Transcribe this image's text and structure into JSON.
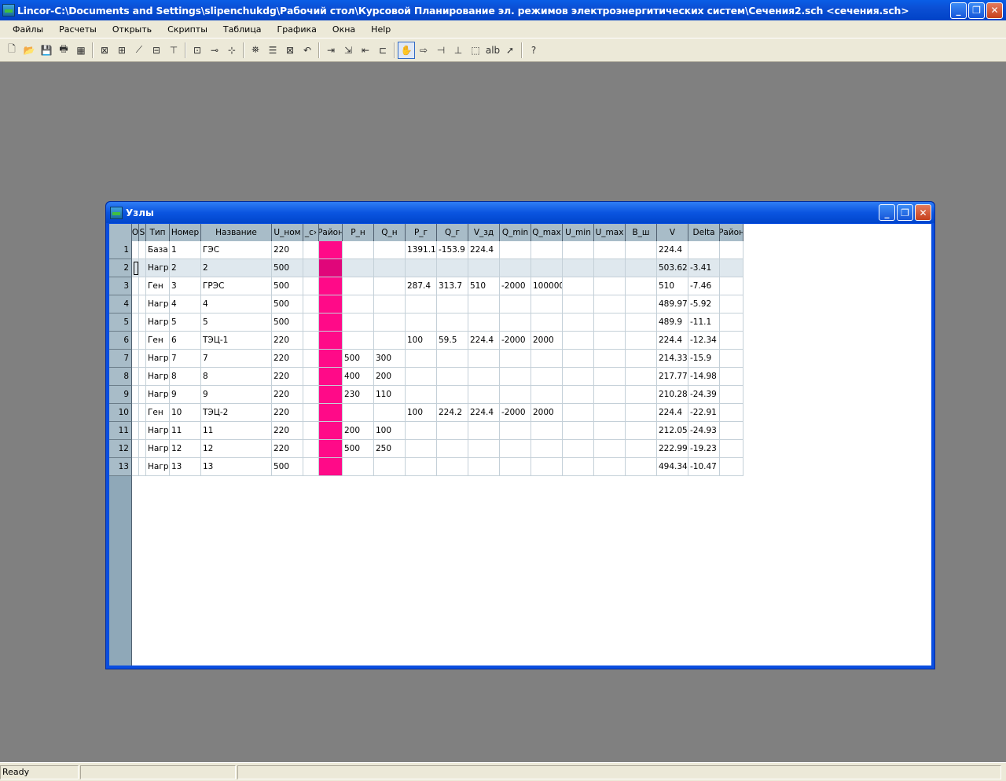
{
  "window": {
    "title": "Lincor-C:\\Documents and Settings\\slipenchukdg\\Рабочий стол\\Курсовой Планирование эл. режимов электроэнергитических систем\\Сечения2.sch <сечения.sch>",
    "minimize": "_",
    "maximize": "❐",
    "close": "✕"
  },
  "menu": [
    "Файлы",
    "Расчеты",
    "Открыть",
    "Скрипты",
    "Таблица",
    "Графика",
    "Окна",
    "Help"
  ],
  "toolbar": [
    "new-file-icon",
    "open-folder-icon",
    "save-icon",
    "print-icon",
    "table-icon",
    "sep",
    "tool-1-icon",
    "tool-2-icon",
    "tool-3-icon",
    "tool-4-icon",
    "tool-5-icon",
    "sep",
    "tool-6-icon",
    "tool-7-icon",
    "tool-8-icon",
    "sep",
    "binoculars-icon",
    "list-icon",
    "excel-icon",
    "undo-icon",
    "sep",
    "node-add-icon",
    "node-link-icon",
    "node-left-icon",
    "node-box-icon",
    "sep",
    "hand-icon",
    "arrow-right-icon",
    "branch-icon",
    "branch-end-icon",
    "select-icon",
    "text-ab-icon",
    "pointer-icon",
    "sep",
    "help-icon"
  ],
  "toolbar_labels": {
    "text-ab-icon": "alb"
  },
  "child": {
    "title": "Узлы",
    "minimize": "_",
    "maximize": "❐",
    "close": "✕"
  },
  "grid": {
    "columns": [
      "",
      "O",
      "S",
      "Тип",
      "Номер",
      "Название",
      "U_ном",
      "_с›",
      "Район",
      "P_н",
      "Q_н",
      "P_г",
      "Q_г",
      "V_зд",
      "Q_min",
      "Q_max",
      "U_min",
      "U_max",
      "B_ш",
      "V",
      "Delta",
      "Район"
    ],
    "rows": [
      [
        "1",
        "",
        "",
        "База",
        "1",
        "ГЭС",
        "220",
        "",
        "",
        "",
        "",
        "1391.1",
        "-153.9",
        "224.4",
        "",
        "",
        "",
        "",
        "",
        "224.4",
        "",
        ""
      ],
      [
        "2",
        "",
        "",
        "Нагр",
        "2",
        "2",
        "500",
        "",
        "",
        "",
        "",
        "",
        "",
        "",
        "",
        "",
        "",
        "",
        "",
        "503.62",
        "-3.41",
        ""
      ],
      [
        "3",
        "",
        "",
        "Ген",
        "3",
        "ГРЭС",
        "500",
        "",
        "",
        "",
        "",
        "287.4",
        "313.7",
        "510",
        "-2000",
        "100000",
        "",
        "",
        "",
        "510",
        "-7.46",
        ""
      ],
      [
        "4",
        "",
        "",
        "Нагр",
        "4",
        "4",
        "500",
        "",
        "",
        "",
        "",
        "",
        "",
        "",
        "",
        "",
        "",
        "",
        "",
        "489.97",
        "-5.92",
        ""
      ],
      [
        "5",
        "",
        "",
        "Нагр",
        "5",
        "5",
        "500",
        "",
        "",
        "",
        "",
        "",
        "",
        "",
        "",
        "",
        "",
        "",
        "",
        "489.9",
        "-11.1",
        ""
      ],
      [
        "6",
        "",
        "",
        "Ген",
        "6",
        "ТЭЦ-1",
        "220",
        "",
        "",
        "",
        "",
        "100",
        "59.5",
        "224.4",
        "-2000",
        "2000",
        "",
        "",
        "",
        "224.4",
        "-12.34",
        ""
      ],
      [
        "7",
        "",
        "",
        "Нагр",
        "7",
        "7",
        "220",
        "",
        "",
        "500",
        "300",
        "",
        "",
        "",
        "",
        "",
        "",
        "",
        "",
        "214.33",
        "-15.9",
        ""
      ],
      [
        "8",
        "",
        "",
        "Нагр",
        "8",
        "8",
        "220",
        "",
        "",
        "400",
        "200",
        "",
        "",
        "",
        "",
        "",
        "",
        "",
        "",
        "217.77",
        "-14.98",
        ""
      ],
      [
        "9",
        "",
        "",
        "Нагр",
        "9",
        "9",
        "220",
        "",
        "",
        "230",
        "110",
        "",
        "",
        "",
        "",
        "",
        "",
        "",
        "",
        "210.28",
        "-24.39",
        ""
      ],
      [
        "10",
        "",
        "",
        "Ген",
        "10",
        "ТЭЦ-2",
        "220",
        "",
        "",
        "",
        "",
        "100",
        "224.2",
        "224.4",
        "-2000",
        "2000",
        "",
        "",
        "",
        "224.4",
        "-22.91",
        ""
      ],
      [
        "11",
        "",
        "",
        "Нагр",
        "11",
        "11",
        "220",
        "",
        "",
        "200",
        "100",
        "",
        "",
        "",
        "",
        "",
        "",
        "",
        "",
        "212.05",
        "-24.93",
        ""
      ],
      [
        "12",
        "",
        "",
        "Нагр",
        "12",
        "12",
        "220",
        "",
        "",
        "500",
        "250",
        "",
        "",
        "",
        "",
        "",
        "",
        "",
        "",
        "222.99",
        "-19.23",
        ""
      ],
      [
        "13",
        "",
        "",
        "Нагр",
        "13",
        "13",
        "500",
        "",
        "",
        "",
        "",
        "",
        "",
        "",
        "",
        "",
        "",
        "",
        "",
        "494.34",
        "-10.47",
        ""
      ]
    ],
    "selected_row": 1,
    "region_color": "#ff0a88"
  },
  "status": [
    "Ready",
    "",
    ""
  ]
}
